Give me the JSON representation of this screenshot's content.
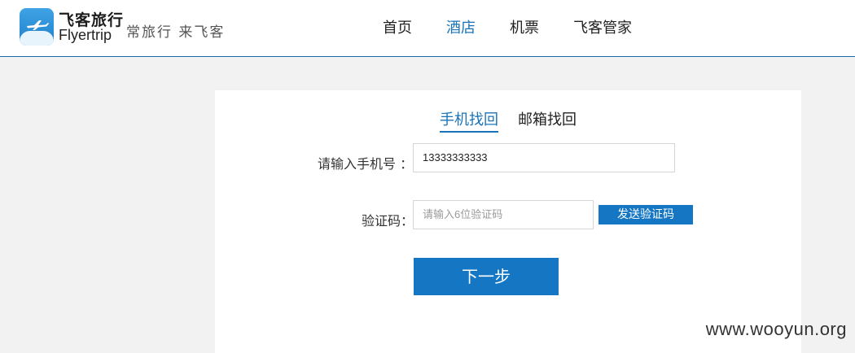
{
  "header": {
    "logo_cn": "飞客旅行",
    "logo_en": "Flyertrip",
    "slogan": "常旅行 来飞客",
    "nav": [
      {
        "label": "首页",
        "active": false
      },
      {
        "label": "酒店",
        "active": true
      },
      {
        "label": "机票",
        "active": false
      },
      {
        "label": "飞客管家",
        "active": false
      }
    ]
  },
  "form": {
    "tabs": [
      {
        "label": "手机找回",
        "active": true
      },
      {
        "label": "邮箱找回",
        "active": false
      }
    ],
    "phone_label": "请输入手机号 ：",
    "phone_value": "13333333333",
    "code_label": "验证码：",
    "code_placeholder": "请输入6位验证码",
    "send_code_label": "发送验证码",
    "next_label": "下一步"
  },
  "watermark": "www.wooyun.org",
  "colors": {
    "accent": "#1577c4",
    "active_text": "#1a73b8",
    "background": "#f2f2f2"
  },
  "icons": {
    "logo": "airplane-over-cloud-icon"
  }
}
